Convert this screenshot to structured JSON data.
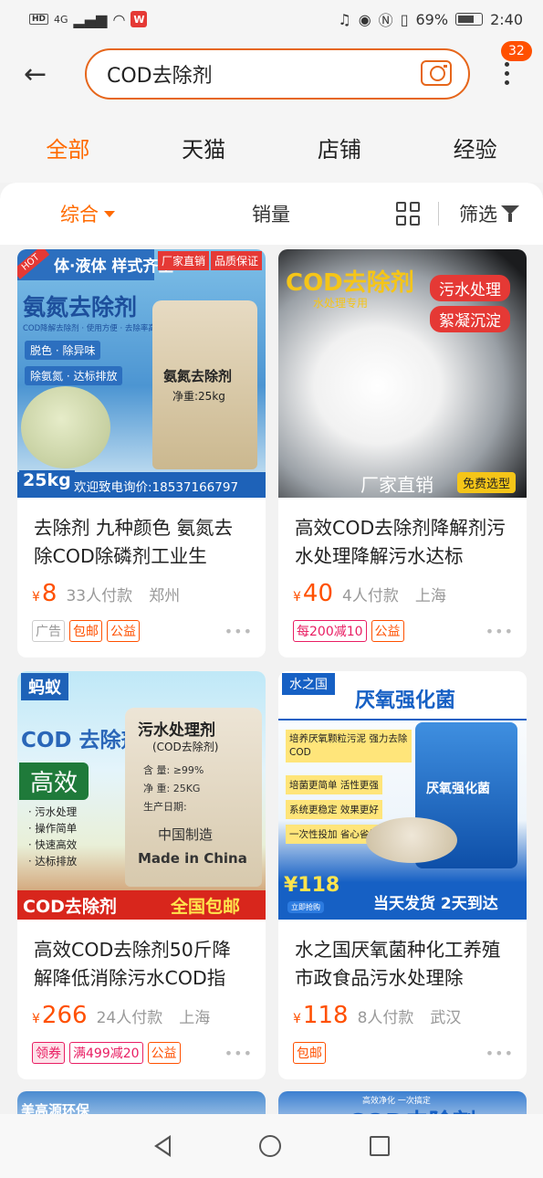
{
  "status_bar": {
    "network": "4G",
    "battery": "69%",
    "battery_level": 0.69,
    "time": "2:40"
  },
  "header": {
    "search_value": "COD去除剂",
    "back_icon": "arrow-left-icon",
    "camera_icon": "camera-icon",
    "more_icon": "more-vertical-icon",
    "message_badge": "32"
  },
  "tabs": [
    {
      "label": "全部",
      "active": true
    },
    {
      "label": "天猫",
      "active": false
    },
    {
      "label": "店铺",
      "active": false
    },
    {
      "label": "经验",
      "active": false
    }
  ],
  "sort_bar": {
    "comprehensive": "综合",
    "sales": "销量",
    "filter": "筛选"
  },
  "products": [
    {
      "title": "去除剂 九种颜色 氨氮去除COD除磷剂工业生",
      "price": "8",
      "sold": "33人付款",
      "location": "郑州",
      "tags": [
        "广告",
        "包邮",
        "公益"
      ],
      "image_text": {
        "banner": "体·液体 样式齐全",
        "badge_hot": "HOT",
        "corner_1": "厂家直销",
        "corner_2": "品质保证",
        "headline": "氨氮去除剂",
        "sub": "COD降解去除剂 · 使用方便 · 去除率高",
        "chip_1": "脱色 · 除异味",
        "chip_2": "除氨氮 · 达标排放",
        "bag_title": "氨氮去除剂",
        "bag_weight": "净重:25kg",
        "weight_badge": "25kg",
        "footer": "欢迎致电询价:18537166797"
      }
    },
    {
      "title": "高效COD去除剂降解剂污水处理降解污水达标",
      "price": "40",
      "sold": "4人付款",
      "location": "上海",
      "tags": [
        "每200减10",
        "公益"
      ],
      "image_text": {
        "headline": "COD去除剂",
        "sub": "水处理专用",
        "chip_1": "污水处理",
        "chip_2": "絮凝沉淀",
        "footer_1": "厂家直销",
        "footer_2": "免费选型"
      }
    },
    {
      "title": "高效COD去除剂50斤降解降低消除污水COD指",
      "price": "266",
      "sold": "24人付款",
      "location": "上海",
      "tags": [
        "领券",
        "满499减20",
        "公益"
      ],
      "image_text": {
        "brand": "蚂蚁",
        "headline": "COD 去除剂",
        "big": "高效",
        "bullets": [
          "· 污水处理",
          "· 操作简单",
          "· 快速高效",
          "· 达标排放"
        ],
        "bag_title": "污水处理剂",
        "bag_sub": "(COD去除剂)",
        "bag_line_1": "含  量: ≥99%",
        "bag_line_2": "净  重: 25KG",
        "bag_line_3": "生产日期:",
        "bag_line_4": "中国制造",
        "bag_line_5": "Made in China",
        "footer_1": "COD去除剂",
        "footer_2": "全国包邮"
      }
    },
    {
      "title": "水之国厌氧菌种化工养殖市政食品污水处理除",
      "price": "118",
      "sold": "8人付款",
      "location": "武汉",
      "tags": [
        "包邮"
      ],
      "image_text": {
        "brand": "水之国",
        "headline": "厌氧强化菌",
        "points": [
          "培养厌氧颗粒污泥 强力去除COD",
          "培菌更简单 活性更强",
          "系统更稳定 效果更好",
          "一次性投加 省心省钱"
        ],
        "pack_title": "厌氧强化菌",
        "price_badge": "¥118",
        "price_sub": "立即抢购",
        "footer": "当天发货 2天到达"
      }
    },
    {
      "title": "",
      "image_text": {
        "headline": "美高源环保"
      }
    },
    {
      "title": "",
      "image_text": {
        "banner": "高效净化 一次搞定",
        "headline": "COD去除剂"
      }
    }
  ],
  "currency": "¥",
  "nav": {
    "back_icon": "nav-back-triangle-icon",
    "home_icon": "nav-home-circle-icon",
    "recent_icon": "nav-recent-square-icon"
  },
  "colors": {
    "accent": "#ff6a00",
    "price": "#ff5000",
    "search_border": "#e6661b"
  }
}
